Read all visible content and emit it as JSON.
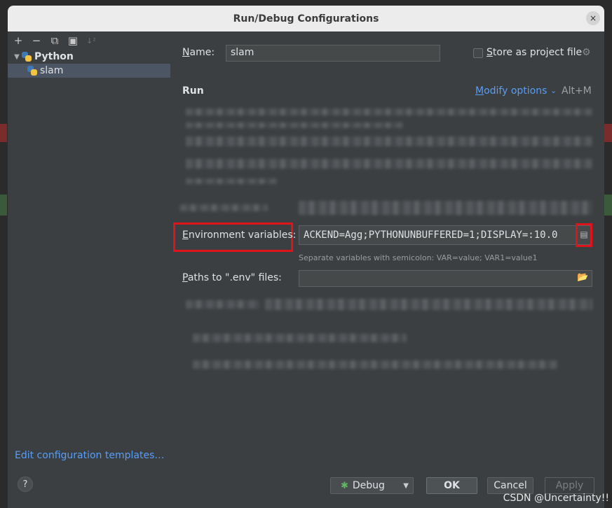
{
  "dialog": {
    "title": "Run/Debug Configurations",
    "close_glyph": "×"
  },
  "toolbar": {
    "add": "+",
    "remove": "−",
    "copy": "⧉",
    "folder": "▣",
    "sort": "↓²"
  },
  "tree": {
    "group": "Python",
    "item": "slam"
  },
  "edit_templates_label": "Edit configuration templates…",
  "help_label": "?",
  "form": {
    "name_label_u": "N",
    "name_label_rest": "ame:",
    "name_value": "slam",
    "store_label_u": "S",
    "store_label_rest": "tore as project file",
    "run_header": "Run",
    "modify_options_u": "M",
    "modify_options_rest": "odify options",
    "modify_shortcut": "Alt+M",
    "env_label_u": "E",
    "env_label_rest": "nvironment variables:",
    "env_value": "ACKEND=Agg;PYTHONUNBUFFERED=1;DISPLAY=:10.0",
    "env_hint": "Separate variables with semicolon: VAR=value; VAR1=value1",
    "paths_label_u": "P",
    "paths_label_rest": "aths to \".env\" files:",
    "paths_value": ""
  },
  "buttons": {
    "debug": "Debug",
    "ok": "OK",
    "cancel": "Cancel",
    "apply": "Apply"
  },
  "watermark": "CSDN @Uncertainty!!",
  "colors": {
    "highlight_box": "#e0131a",
    "link": "#589df6",
    "dialog_bg": "#3c3f41"
  }
}
